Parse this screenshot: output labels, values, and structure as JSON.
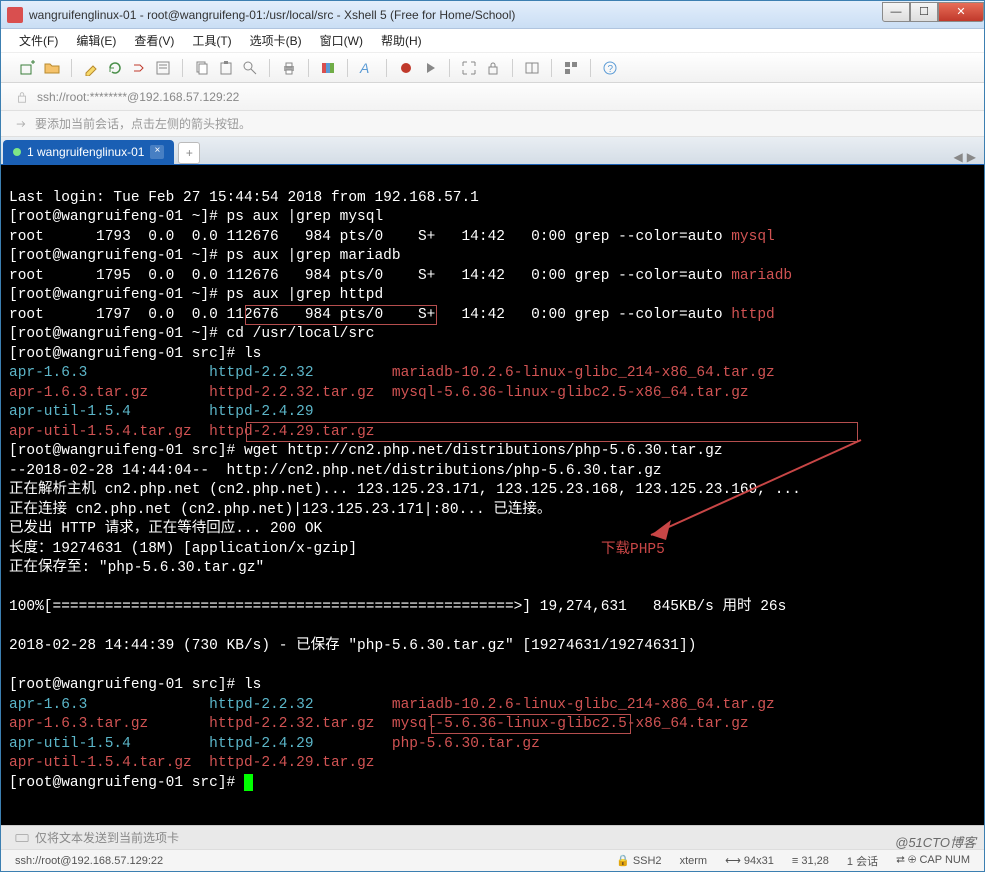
{
  "window": {
    "title": "wangruifenglinux-01 - root@wangruifeng-01:/usr/local/src - Xshell 5 (Free for Home/School)"
  },
  "menu": {
    "file": "文件(F)",
    "edit": "编辑(E)",
    "view": "查看(V)",
    "tools": "工具(T)",
    "tabs": "选项卡(B)",
    "window": "窗口(W)",
    "help": "帮助(H)"
  },
  "address": {
    "text": "ssh://root:********@192.168.57.129:22"
  },
  "hint": {
    "text": "要添加当前会话，点击左侧的箭头按钮。"
  },
  "tab": {
    "label": "1 wangruifenglinux-01"
  },
  "terminal": {
    "l0": "Last login: Tue Feb 27 15:44:54 2018 from 192.168.57.1",
    "l1": "[root@wangruifeng-01 ~]# ps aux |grep mysql",
    "l2a": "root      1793  0.0  0.0 112676   984 pts/0    S+   14:42   0:00 grep --color=auto ",
    "l2b": "mysql",
    "l3": "[root@wangruifeng-01 ~]# ps aux |grep mariadb",
    "l4a": "root      1795  0.0  0.0 112676   984 pts/0    S+   14:42   0:00 grep --color=auto ",
    "l4b": "mariadb",
    "l5": "[root@wangruifeng-01 ~]# ps aux |grep httpd",
    "l6a": "root      1797  0.0  0.0 112676   984 pts/0    S+   14:42   0:00 grep --color=auto ",
    "l6b": "httpd",
    "l7": "[root@wangruifeng-01 ~]# cd /usr/local/src",
    "l8": "[root@wangruifeng-01 src]# ls",
    "g1a": "apr-1.6.3              ",
    "g1b": "httpd-2.2.32         ",
    "g1c": "mariadb-10.2.6-linux-glibc_214-x86_64.tar.gz",
    "g2a": "apr-1.6.3.tar.gz       ",
    "g2b": "httpd-2.2.32.tar.gz  ",
    "g2c": "mysql-5.6.36-linux-glibc2.5-x86_64.tar.gz",
    "g3a": "apr-util-1.5.4         ",
    "g3b": "httpd-2.4.29",
    "g4a": "apr-util-1.5.4.tar.gz  ",
    "g4b": "httpd-2.4.29.tar.gz",
    "l9": "[root@wangruifeng-01 src]# wget http://cn2.php.net/distributions/php-5.6.30.tar.gz",
    "l10": "--2018-02-28 14:44:04--  http://cn2.php.net/distributions/php-5.6.30.tar.gz",
    "l11": "正在解析主机 cn2.php.net (cn2.php.net)... 123.125.23.171, 123.125.23.168, 123.125.23.169, ...",
    "l12": "正在连接 cn2.php.net (cn2.php.net)|123.125.23.171|:80... 已连接。",
    "l13": "已发出 HTTP 请求，正在等待回应... 200 OK",
    "l14": "长度：19274631 (18M) [application/x-gzip]",
    "l15": "正在保存至: \"php-5.6.30.tar.gz\"",
    "l16": "",
    "l17": "100%[=====================================================>] 19,274,631   845KB/s 用时 26s   ",
    "l18": "",
    "l19": "2018-02-28 14:44:39 (730 KB/s) - 已保存 \"php-5.6.30.tar.gz\" [19274631/19274631])",
    "l20": "",
    "l21": "[root@wangruifeng-01 src]# ls",
    "h1a": "apr-1.6.3              ",
    "h1b": "httpd-2.2.32         ",
    "h1c": "mariadb-10.2.6-linux-glibc_214-x86_64.tar.gz",
    "h2a": "apr-1.6.3.tar.gz       ",
    "h2b": "httpd-2.2.32.tar.gz  ",
    "h2c": "mysql-5.6.36-linux-glibc2.5-x86_64.tar.gz",
    "h3a": "apr-util-1.5.4         ",
    "h3b": "httpd-2.4.29         ",
    "h3c": "php-5.6.30.tar.gz",
    "h4a": "apr-util-1.5.4.tar.gz  ",
    "h4b": "httpd-2.4.29.tar.gz",
    "l22": "[root@wangruifeng-01 src]# "
  },
  "annotation": {
    "label": "下载PHP5"
  },
  "sendbar": {
    "text": "仅将文本发送到当前选项卡"
  },
  "status": {
    "path": "ssh://root@192.168.57.129:22",
    "ssh": "SSH2",
    "term": "xterm",
    "size": "94x31",
    "pos": "31,28",
    "sess": "1 会话",
    "cap": "CAP",
    "num": "NUM"
  },
  "watermark": "@51CTO博客"
}
